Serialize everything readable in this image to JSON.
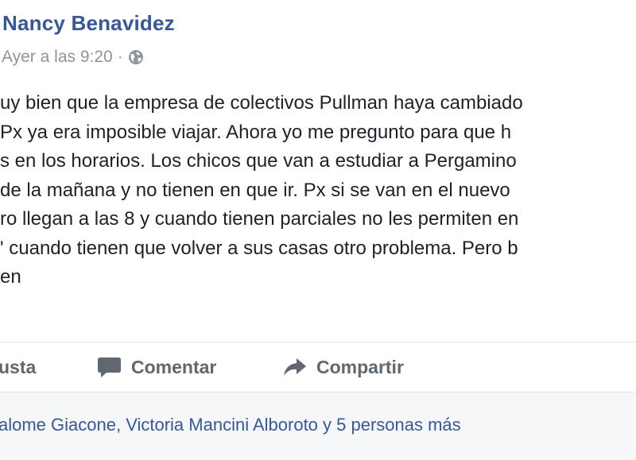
{
  "post": {
    "author": "Nancy Benavidez",
    "timestamp": "Ayer a las 9:20",
    "separator": "·",
    "privacy_icon": "globe-icon",
    "body_lines": [
      "uy bien que la empresa de colectivos Pullman haya cambiado",
      "Px ya era imposible viajar. Ahora yo me pregunto para que h",
      "s en los horarios. Los chicos que van a estudiar a Pergamino",
      "de la mañana y no tienen en que ir. Px si se van en el nuevo",
      "ro llegan a las 8 y cuando tienen parciales no les permiten en",
      "' cuando tienen que volver a sus casas otro problema. Pero b",
      "en"
    ]
  },
  "actions": {
    "like_label": "usta",
    "comment_label": "Comentar",
    "share_label": "Compartir",
    "comment_icon": "comment-icon",
    "share_icon": "share-icon"
  },
  "reactions": {
    "summary": "alome Giacone, Victoria Mancini Alboroto y 5 personas más"
  },
  "colors": {
    "link_blue": "#365899",
    "meta_gray": "#90949c",
    "text": "#1d2129",
    "action_gray": "#606770",
    "footer_bg": "#f6f7f9"
  }
}
